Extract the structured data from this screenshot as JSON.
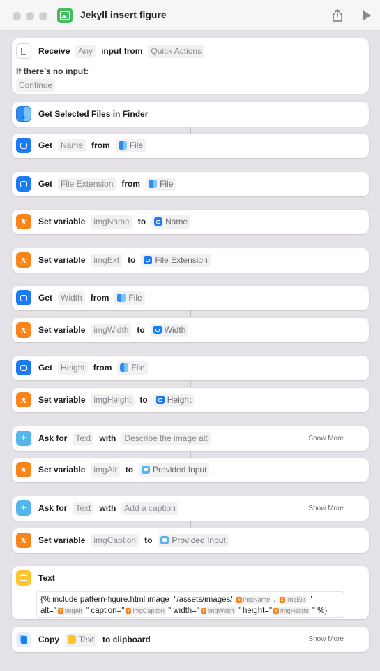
{
  "window": {
    "title": "Jekyll insert figure"
  },
  "receive": {
    "label": "Receive",
    "any": "Any",
    "input_from": "input from",
    "source": "Quick Actions",
    "no_input_label": "If there’s no input:",
    "no_input_action": "Continue"
  },
  "actions": [
    {
      "kw1": "Get Selected Files in Finder"
    },
    {
      "kw1": "Get",
      "t1": "Name",
      "kw2": "from",
      "t2": "File"
    },
    {
      "kw1": "Get",
      "t1": "File Extension",
      "kw2": "from",
      "t2": "File"
    },
    {
      "kw1": "Set variable",
      "t1": "imgName",
      "kw2": "to",
      "t2": "Name"
    },
    {
      "kw1": "Set variable",
      "t1": "imgExt",
      "kw2": "to",
      "t2": "File Extension"
    },
    {
      "kw1": "Get",
      "t1": "Width",
      "kw2": "from",
      "t2": "File"
    },
    {
      "kw1": "Set variable",
      "t1": "imgWidth",
      "kw2": "to",
      "t2": "Width"
    },
    {
      "kw1": "Get",
      "t1": "Height",
      "kw2": "from",
      "t2": "File"
    },
    {
      "kw1": "Set variable",
      "t1": "imgHeight",
      "kw2": "to",
      "t2": "Height"
    },
    {
      "kw1": "Ask for",
      "t1": "Text",
      "kw2": "with",
      "t2": "Describe the image alt",
      "more": "Show More"
    },
    {
      "kw1": "Set variable",
      "t1": "imgAlt",
      "kw2": "to",
      "t2": "Provided Input"
    },
    {
      "kw1": "Ask for",
      "t1": "Text",
      "kw2": "with",
      "t2": "Add a caption",
      "more": "Show More"
    },
    {
      "kw1": "Set variable",
      "t1": "imgCaption",
      "kw2": "to",
      "t2": "Provided Input"
    }
  ],
  "text_action": {
    "label": "Text",
    "l1_a": "{% include pattern-figure.html image=\"/assets/images/",
    "v_name": "imgName",
    "dot": ".",
    "v_ext": "imgExt",
    "q1": "\"",
    "l2_a": "alt=\"",
    "v_alt": "imgAlt",
    "l2_b": "\" caption=\"",
    "v_caption": "imgCaption",
    "l2_c": "\" width=\"",
    "v_width": "imgWidth",
    "l2_d": "\" height=\"",
    "v_height": "imgHeight",
    "l2_e": "\" %}"
  },
  "copy_action": {
    "kw1": "Copy",
    "t1": "Text",
    "kw2": "to clipboard",
    "more": "Show More"
  },
  "colors": {
    "blue": "#1a7bf2",
    "orange": "#f8851b",
    "sky": "#55b6ee",
    "yellow": "#fcc52c",
    "green": "#3fbf5e"
  }
}
